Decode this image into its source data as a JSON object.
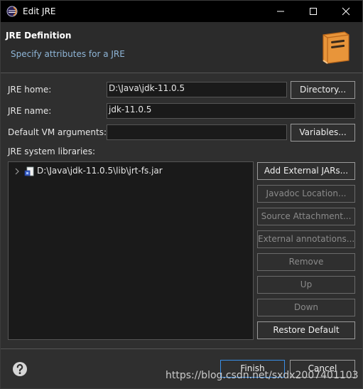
{
  "titlebar": {
    "title": "Edit JRE",
    "icon": "eclipse-icon",
    "controls": [
      "minimize-icon",
      "maximize-icon",
      "close-icon"
    ]
  },
  "header": {
    "title": "JRE Definition",
    "subtitle": "Specify attributes for a JRE",
    "icon": "book-icon"
  },
  "form": {
    "jre_home_label": "JRE home:",
    "jre_home_value": "D:\\Java\\jdk-11.0.5",
    "directory_button": "Directory...",
    "jre_name_label": "JRE name:",
    "jre_name_value": "jdk-11.0.5",
    "vm_args_label": "Default VM arguments:",
    "vm_args_value": "",
    "variables_button": "Variables...",
    "libraries_label": "JRE system libraries:"
  },
  "libraries": {
    "items": [
      {
        "label": "D:\\Java\\jdk-11.0.5\\lib\\jrt-fs.jar",
        "icon": "jar-icon",
        "expanded": false
      }
    ]
  },
  "side_buttons": [
    {
      "label": "Add External JARs...",
      "enabled": true
    },
    {
      "label": "Javadoc Location...",
      "enabled": false
    },
    {
      "label": "Source Attachment...",
      "enabled": false
    },
    {
      "label": "External annotations...",
      "enabled": false
    },
    {
      "label": "Remove",
      "enabled": false
    },
    {
      "label": "Up",
      "enabled": false
    },
    {
      "label": "Down",
      "enabled": false
    },
    {
      "label": "Restore Default",
      "enabled": true
    }
  ],
  "footer": {
    "help_icon": "help-icon",
    "finish_button": "Finish",
    "cancel_button": "Cancel"
  },
  "watermark": "https://blog.csdn.net/sxdx2007401103",
  "colors": {
    "accent": "#3a8ee6",
    "subtitle": "#8fb6d8",
    "book": "#e8953a"
  }
}
